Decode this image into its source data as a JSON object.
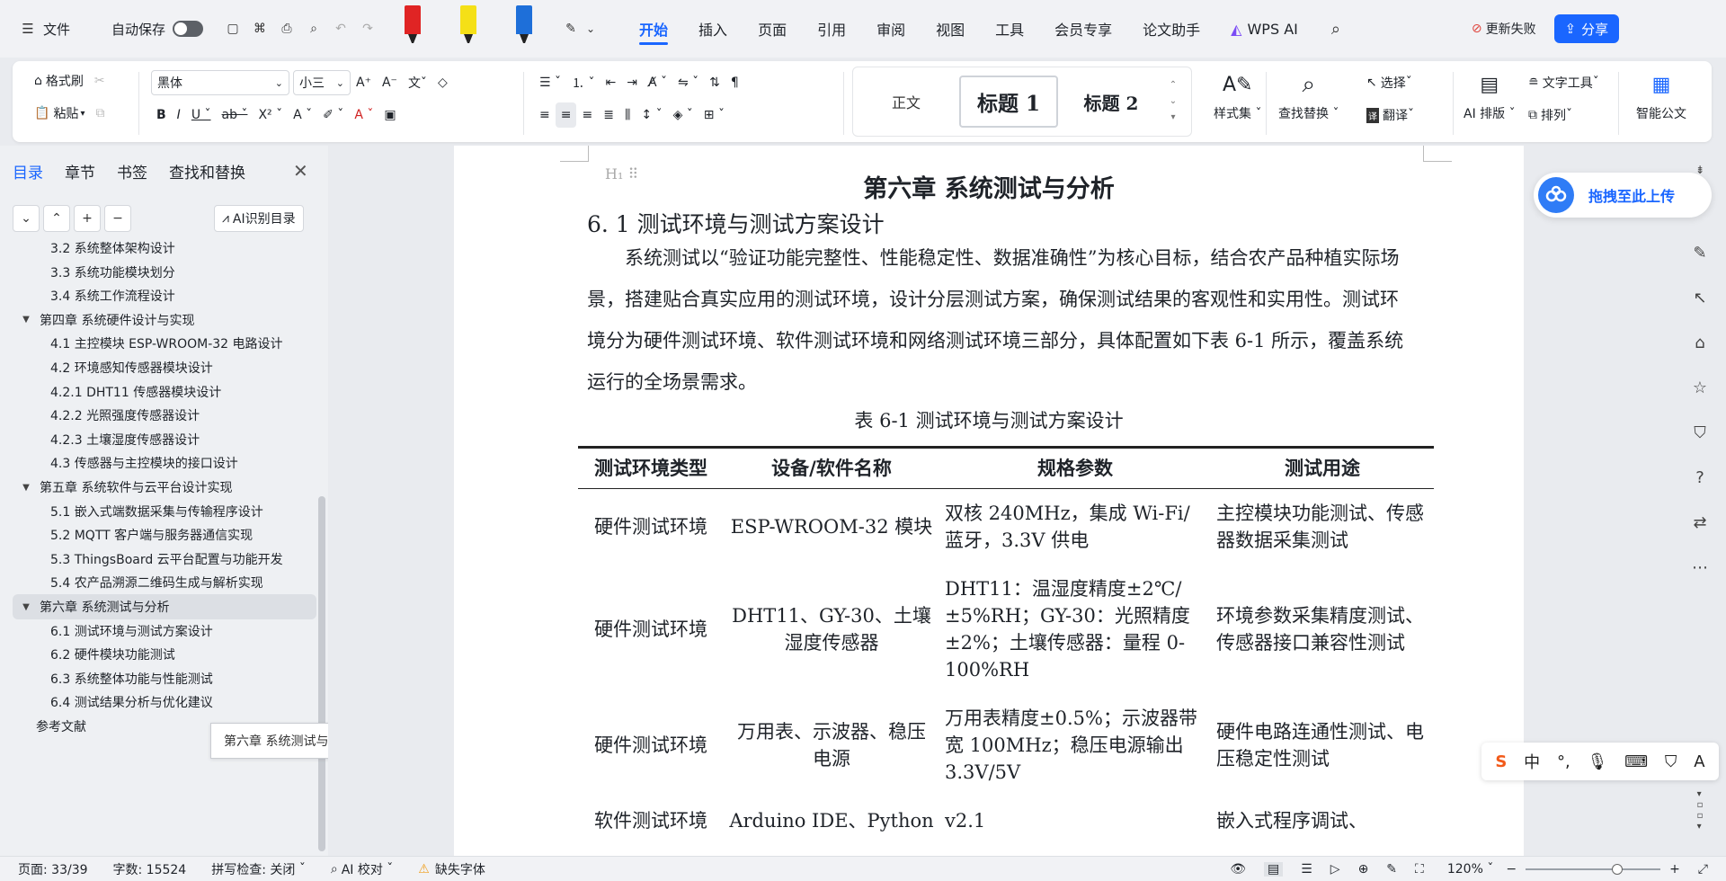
{
  "topbar": {
    "menu_label": "文件",
    "autosave_label": "自动保存",
    "tabs": [
      "开始",
      "插入",
      "页面",
      "引用",
      "审阅",
      "视图",
      "工具",
      "会员专享",
      "论文助手",
      "WPS AI"
    ],
    "active_tab": "开始",
    "update_label": "更新失败",
    "share_label": "分享",
    "pens": [
      {
        "name": "red-pen-icon",
        "color": "#e02424"
      },
      {
        "name": "yellow-pen-icon",
        "color": "#f5e017"
      },
      {
        "name": "blue-pen-icon",
        "color": "#1e6fd9"
      }
    ]
  },
  "ribbon": {
    "format_painter": "格式刷",
    "paste": "粘贴",
    "font_name": "黑体",
    "font_size": "小三",
    "styles": [
      "正文",
      "标题 1",
      "标题 2"
    ],
    "style_set": "样式集",
    "find_replace": "查找替换",
    "select": "选择",
    "translate": "翻译",
    "ai_layout": "AI 排版",
    "text_tools": "文字工具",
    "arrange": "排列",
    "smart_doc": "智能公文"
  },
  "nav": {
    "tabs": [
      "目录",
      "章节",
      "书签",
      "查找和替换"
    ],
    "active_tab": "目录",
    "ai_toc": "AI识别目录",
    "items": [
      {
        "label": "3.2  系统整体架构设计",
        "level": 2
      },
      {
        "label": "3.3  系统功能模块划分",
        "level": 2
      },
      {
        "label": "3.4  系统工作流程设计",
        "level": 2
      },
      {
        "label": "第四章  系统硬件设计与实现",
        "level": 1
      },
      {
        "label": "4.1  主控模块  ESP-WROOM-32  电路设计",
        "level": 2
      },
      {
        "label": "4.2  环境感知传感器模块设计",
        "level": 2
      },
      {
        "label": "4.2.1 DHT11  传感器模块设计",
        "level": 2
      },
      {
        "label": "4.2.2  光照强度传感器设计",
        "level": 2
      },
      {
        "label": "4.2.3  土壤湿度传感器设计",
        "level": 2
      },
      {
        "label": "4.3  传感器与主控模块的接口设计",
        "level": 2
      },
      {
        "label": "第五章  系统软件与云平台设计实现",
        "level": 1
      },
      {
        "label": "5.1  嵌入式端数据采集与传输程序设计",
        "level": 2
      },
      {
        "label": "5.2 MQTT 客户端与服务器通信实现",
        "level": 2
      },
      {
        "label": "5.3 ThingsBoard 云平台配置与功能开发",
        "level": 2
      },
      {
        "label": "5.4  农产品溯源二维码生成与解析实现",
        "level": 2
      },
      {
        "label": "第六章  系统测试与分析",
        "level": 1
      },
      {
        "label": "6.1  测试环境与测试方案设计",
        "level": 2
      },
      {
        "label": "6.2  硬件模块功能测试",
        "level": 2
      },
      {
        "label": "6.3  系统整体功能与性能测试",
        "level": 2
      },
      {
        "label": "6.4  测试结果分析与优化建议",
        "level": 2
      },
      {
        "label": "参考文献",
        "level": 0
      }
    ],
    "selected_index": 15,
    "tooltip": "第六章 系统测试与分析"
  },
  "document": {
    "chapter_title": "第六章  系统测试与分析",
    "section_title": "6. 1  测试环境与测试方案设计",
    "paragraph": "系统测试以“验证功能完整性、性能稳定性、数据准确性”为核心目标，结合农产品种植实际场景，搭建贴合真实应用的测试环境，设计分层测试方案，确保测试结果的客观性和实用性。测试环境分为硬件测试环境、软件测试环境和网络测试环境三部分，具体配置如下表 6-1 所示，覆盖系统运行的全场景需求。",
    "table_caption": "表 6-1  测试环境与测试方案设计",
    "table": {
      "headers": [
        "测试环境类型",
        "设备/软件名称",
        "规格参数",
        "测试用途"
      ],
      "rows": [
        [
          "硬件测试环境",
          "ESP-WROOM-32 模块",
          "双核 240MHz，集成 Wi-Fi/蓝牙，3.3V 供电",
          "主控模块功能测试、传感器数据采集测试"
        ],
        [
          "硬件测试环境",
          "DHT11、GY-30、土壤湿度传感器",
          "DHT11：温湿度精度±2℃/±5%RH；GY-30：光照精度±2%；土壤传感器：量程 0-100%RH",
          "环境参数采集精度测试、传感器接口兼容性测试"
        ],
        [
          "硬件测试环境",
          "万用表、示波器、稳压电源",
          "万用表精度±0.5%；示波器带宽 100MHz；稳压电源输出 3.3V/5V",
          "硬件电路连通性测试、电压稳定性测试"
        ],
        [
          "软件测试环境",
          "Arduino IDE、Python",
          "v2.1",
          "嵌入式程序调试、"
        ]
      ]
    }
  },
  "right": {
    "upload_label": "拖拽至此上传",
    "ime_label": "中"
  },
  "status": {
    "page": "页面: 33/39",
    "words": "字数: 15524",
    "spell": "拼写检查: 关闭",
    "ai_check": "AI 校对",
    "missing_font": "缺失字体",
    "zoom": "120%"
  }
}
